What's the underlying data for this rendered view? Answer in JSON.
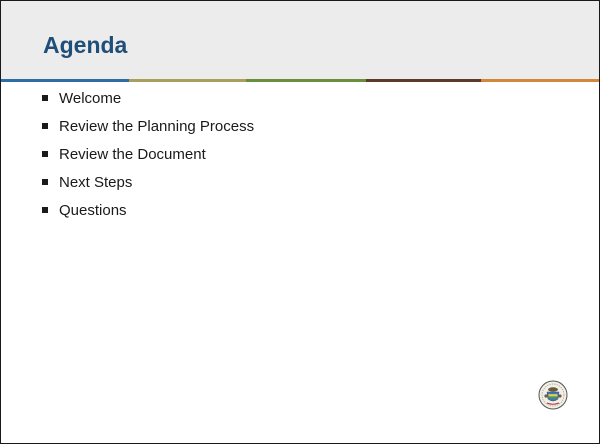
{
  "slide": {
    "title": "Agenda",
    "bullets": [
      "Welcome",
      "Review the Planning Process",
      "Review the Document",
      "Next Steps",
      "Questions"
    ]
  },
  "colors": {
    "title_text": "#1f4e79",
    "title_background": "#ececec",
    "stripe": [
      "#2e6da4",
      "#a89f5b",
      "#6a8f3a",
      "#5b3a2a",
      "#d4873a"
    ]
  },
  "icons": {
    "logo": "state-seal-icon"
  }
}
